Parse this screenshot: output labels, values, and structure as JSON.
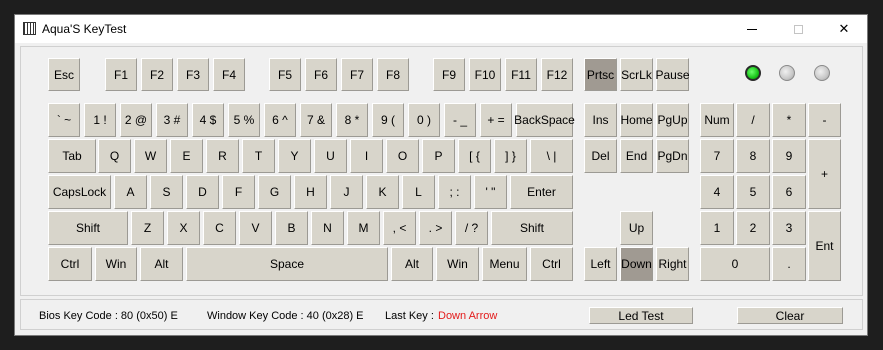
{
  "window": {
    "title": "Aqua'S KeyTest",
    "controls": {
      "minimize": "–",
      "maximize": "□",
      "close": "✕"
    }
  },
  "leds": [
    {
      "name": "num-lock",
      "state": "on"
    },
    {
      "name": "caps-lock",
      "state": "off"
    },
    {
      "name": "scroll-lock",
      "state": "off"
    }
  ],
  "keys": {
    "esc": "Esc",
    "f1": "F1",
    "f2": "F2",
    "f3": "F3",
    "f4": "F4",
    "f5": "F5",
    "f6": "F6",
    "f7": "F7",
    "f8": "F8",
    "f9": "F9",
    "f10": "F10",
    "f11": "F11",
    "f12": "F12",
    "prtsc": "Prtsc",
    "scrlk": "ScrLk",
    "pause": "Pause",
    "backtick": "` ~",
    "1": "1 !",
    "2": "2 @",
    "3": "3 #",
    "4": "4 $",
    "5": "5 %",
    "6": "6 ^",
    "7": "7 &",
    "8": "8 *",
    "9": "9 (",
    "0": "0 )",
    "minus": "- _",
    "equals": "+ =",
    "backspace": "BackSpace",
    "ins": "Ins",
    "home": "Home",
    "pgup": "PgUp",
    "numlock": "Num",
    "num-div": "/",
    "num-mul": "*",
    "num-minus": "-",
    "tab": "Tab",
    "q": "Q",
    "w": "W",
    "e": "E",
    "r": "R",
    "t": "T",
    "y": "Y",
    "u": "U",
    "i": "I",
    "o": "O",
    "p": "P",
    "lbracket": "[ {",
    "rbracket": "] }",
    "backslash": "\\ |",
    "del": "Del",
    "end": "End",
    "pgdn": "PgDn",
    "num7": "7",
    "num8": "8",
    "num9": "9",
    "num-plus": "+",
    "capslock": "CapsLock",
    "a": "A",
    "s": "S",
    "d": "D",
    "f": "F",
    "g": "G",
    "h": "H",
    "j": "J",
    "k": "K",
    "l": "L",
    "semicolon": "; :",
    "quote": "' \"",
    "enter": "Enter",
    "num4": "4",
    "num5": "5",
    "num6": "6",
    "lshift": "Shift",
    "z": "Z",
    "x": "X",
    "c": "C",
    "v": "V",
    "b": "B",
    "n": "N",
    "m": "M",
    "comma": ", <",
    "period": ". >",
    "slash": "/ ?",
    "rshift": "Shift",
    "up": "Up",
    "num1": "1",
    "num2": "2",
    "num3": "3",
    "num-enter": "Ent",
    "lctrl": "Ctrl",
    "lwin": "Win",
    "lalt": "Alt",
    "space": "Space",
    "ralt": "Alt",
    "rwin": "Win",
    "menu": "Menu",
    "rctrl": "Ctrl",
    "left": "Left",
    "down": "Down",
    "right": "Right",
    "num0": "0",
    "num-dot": "."
  },
  "pressed_keys": [
    "prtsc",
    "down"
  ],
  "status": {
    "bios_key_code": "Bios Key Code : 80 (0x50) E",
    "window_key_code": "Window Key Code : 40 (0x28) E",
    "last_key_label": "Last Key :",
    "last_key_value": "Down Arrow",
    "led_test_button": "Led Test",
    "clear_button": "Clear"
  },
  "colors": {
    "key_face": "#d8d5cb",
    "key_pressed": "#a09a92",
    "last_key_text": "#e31b1b",
    "led_on": "#19c519"
  }
}
